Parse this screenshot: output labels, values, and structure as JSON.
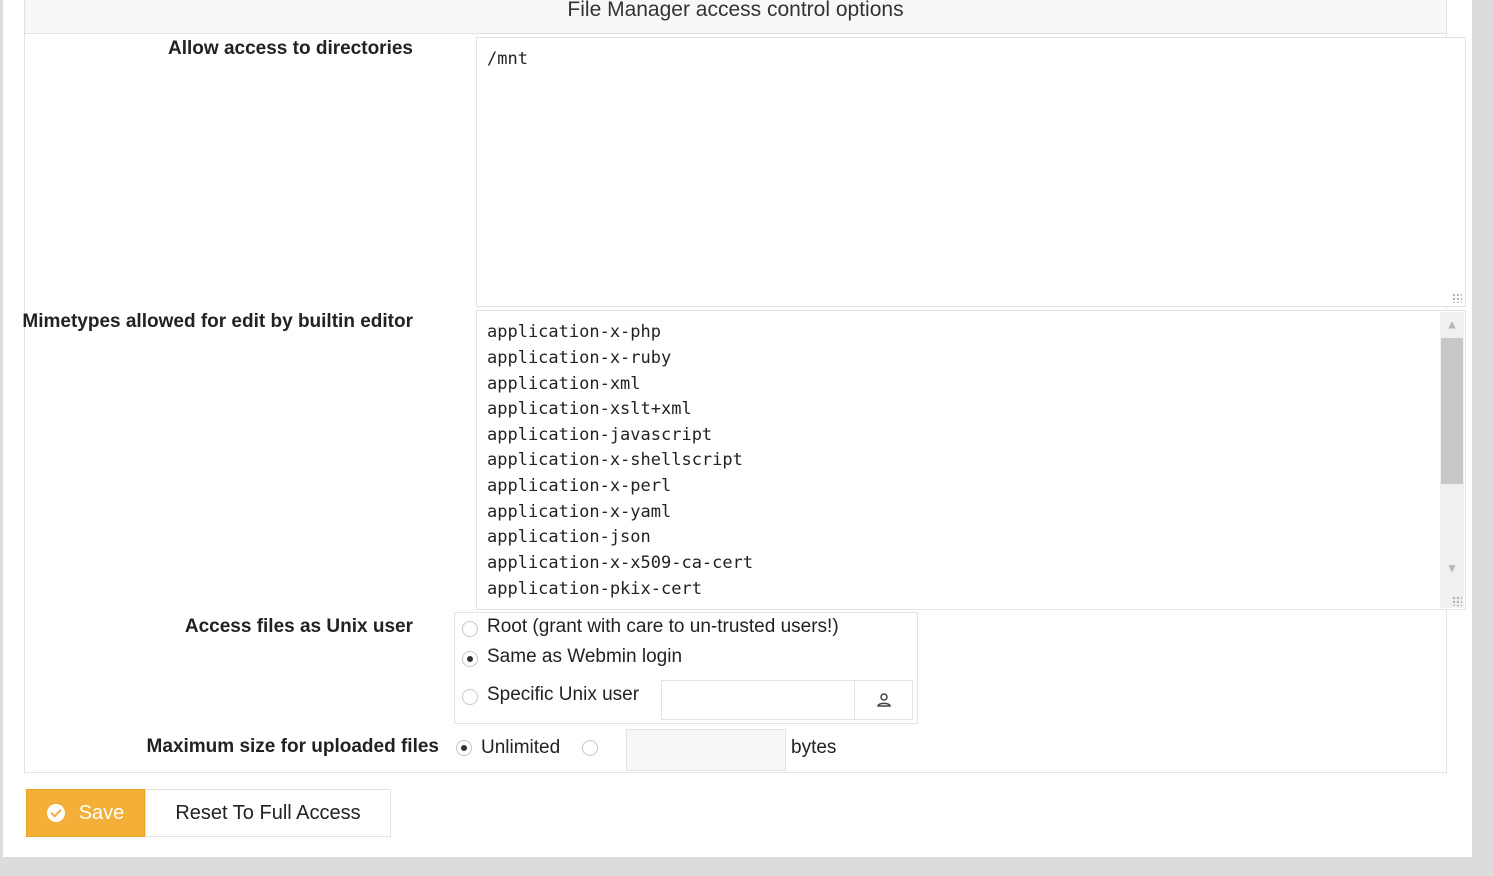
{
  "panel": {
    "title": "File Manager access control options"
  },
  "directories": {
    "label": "Allow access to directories",
    "value": "/mnt"
  },
  "mimetypes": {
    "label": "Mimetypes allowed for edit by builtin editor",
    "lines": [
      "application-x-php",
      "application-x-ruby",
      "application-xml",
      "application-xslt+xml",
      "application-javascript",
      "application-x-shellscript",
      "application-x-perl",
      "application-x-yaml",
      "application-json",
      "application-x-x509-ca-cert",
      "application-pkix-cert"
    ]
  },
  "unix_user": {
    "label": "Access files as Unix user",
    "options": [
      {
        "label": "Root (grant with care to un-trusted users!)",
        "selected": false
      },
      {
        "label": "Same as Webmin login",
        "selected": true
      },
      {
        "label": "Specific Unix user",
        "selected": false
      }
    ],
    "specific_user_value": "",
    "icon": "user-icon"
  },
  "upload_size": {
    "label": "Maximum size for uploaded files",
    "unlimited_label": "Unlimited",
    "unlimited_selected": true,
    "size_value": "",
    "unit_label": "bytes"
  },
  "buttons": {
    "save_label": "Save",
    "reset_label": "Reset To Full Access"
  },
  "colors": {
    "save_button": "#f3af37",
    "page_bg": "#dcdcdc"
  }
}
